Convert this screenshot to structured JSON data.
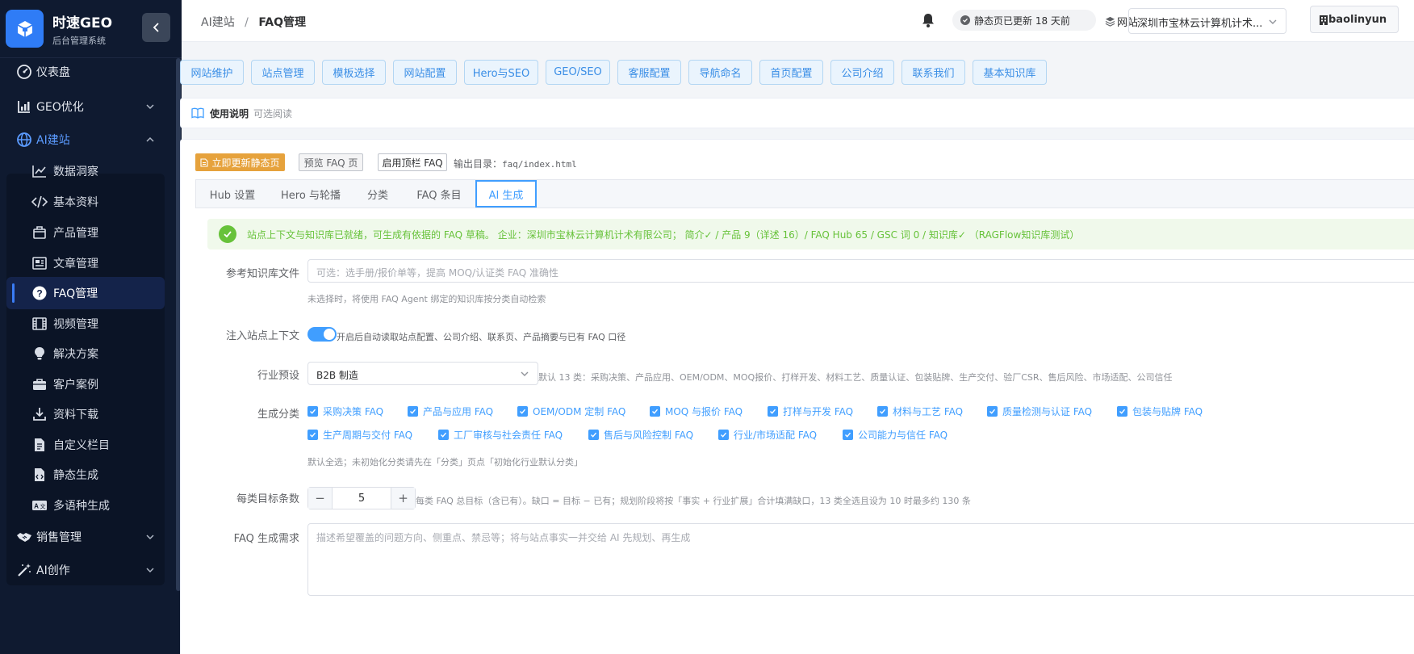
{
  "app": {
    "title": "时速GEO",
    "subtitle": "后台管理系统"
  },
  "sidebar": {
    "top_items": [
      {
        "label": "仪表盘"
      },
      {
        "label": "GEO优化"
      },
      {
        "label": "AI建站"
      }
    ],
    "sub_items": [
      {
        "label": "数据洞察"
      },
      {
        "label": "基本资料"
      },
      {
        "label": "产品管理"
      },
      {
        "label": "文章管理"
      },
      {
        "label": "FAQ管理"
      },
      {
        "label": "视频管理"
      },
      {
        "label": "解决方案"
      },
      {
        "label": "客户案例"
      },
      {
        "label": "资料下载"
      },
      {
        "label": "自定义栏目"
      },
      {
        "label": "静态生成"
      },
      {
        "label": "多语种生成"
      }
    ],
    "bottom_items": [
      {
        "label": "销售管理"
      },
      {
        "label": "AI创作"
      }
    ]
  },
  "header": {
    "breadcrumb_parent": "AI建站",
    "breadcrumb_sep": "/",
    "breadcrumb_current": "FAQ管理",
    "status_text": "静态页已更新 18 天前",
    "site_label": "网站",
    "site_value": "深圳市宝林云计算机计术...",
    "username": "baolinyun"
  },
  "topnav": [
    "网站维护",
    "站点管理",
    "模板选择",
    "网站配置",
    "Hero与SEO",
    "GEO/SEO",
    "客服配置",
    "导航命名",
    "首页配置",
    "公司介绍",
    "联系我们",
    "基本知识库"
  ],
  "usage": {
    "title": "使用说明",
    "note": "可选阅读"
  },
  "toolbar": {
    "update_btn": "立即更新静态页",
    "preview_btn": "预览 FAQ 页",
    "enable_btn": "启用顶栏 FAQ",
    "output_label": "输出目录：",
    "output_path": "faq/index.html"
  },
  "tabs": [
    "Hub 设置",
    "Hero 与轮播",
    "分类",
    "FAQ 条目",
    "AI 生成"
  ],
  "alert": {
    "message": "站点上下文与知识库已就绪，可生成有依据的 FAQ 草稿。 企业：深圳市宝林云计算机计术有限公司； 简介✓ / 产品 9（详述 16）/ FAQ Hub 65 / GSC 词 0 / 知识库✓ （RAGFlow知识库测试）"
  },
  "form": {
    "kb_label": "参考知识库文件",
    "kb_placeholder": "可选：选手册/报价单等，提高 MOQ/认证类 FAQ 准确性",
    "kb_hint": "未选择时，将使用 FAQ Agent 绑定的知识库按分类自动检索",
    "inject_label": "注入站点上下文",
    "inject_on": true,
    "inject_text": "开启后自动读取站点配置、公司介绍、联系页、产品摘要与已有 FAQ 口径",
    "preset_label": "行业预设",
    "preset_value": "B2B 制造",
    "preset_hint": "默认 13 类：采购决策、产品应用、OEM/ODM、MOQ报价、打样开发、材料工艺、质量认证、包装贴牌、生产交付、验厂CSR、售后风险、市场适配、公司信任",
    "cat_label": "生成分类",
    "categories": [
      "采购决策 FAQ",
      "产品与应用 FAQ",
      "OEM/ODM 定制 FAQ",
      "MOQ 与报价 FAQ",
      "打样与开发 FAQ",
      "材料与工艺 FAQ",
      "质量检测与认证 FAQ",
      "包装与贴牌 FAQ",
      "生产周期与交付 FAQ",
      "工厂审核与社会责任 FAQ",
      "售后与风险控制 FAQ",
      "行业/市场适配 FAQ",
      "公司能力与信任 FAQ"
    ],
    "cat_hint": "默认全选；未初始化分类请先在「分类」页点「初始化行业默认分类」",
    "target_label": "每类目标条数",
    "target_minus": "−",
    "target_value": "5",
    "target_plus": "+",
    "target_hint": "每类 FAQ 总目标（含已有）。缺口 = 目标 − 已有；规划阶段将按「事实 + 行业扩展」合计填满缺口，13 类全选且设为 10 时最多约 130 条",
    "need_label": "FAQ 生成需求",
    "need_placeholder": "描述希望覆盖的问题方向、侧重点、禁忌等；将与站点事实一并交给 AI 先规划、再生成"
  },
  "colors": {
    "primary": "#409eff",
    "success": "#67c23a",
    "warning": "#e6a23c",
    "sidebar_bg": "#0f1a30"
  }
}
